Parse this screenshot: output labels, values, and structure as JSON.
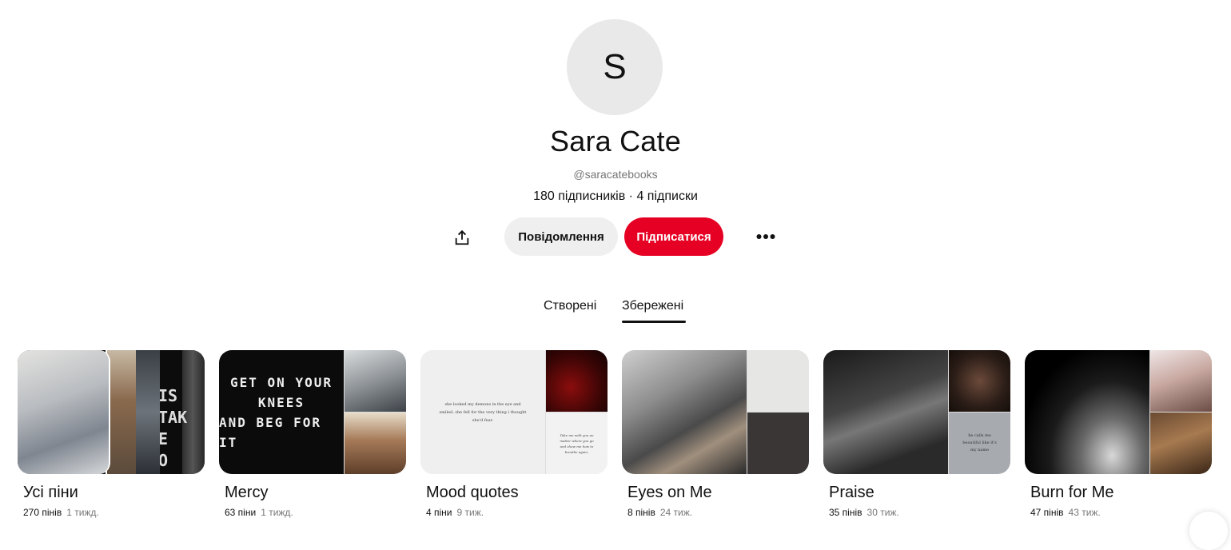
{
  "profile": {
    "initial": "S",
    "name": "Sara Cate",
    "handle": "@saracatebooks",
    "stats": "180 підписників · 4 підписки"
  },
  "actions": {
    "message_label": "Повідомлення",
    "follow_label": "Підписатися",
    "share_icon": "share-icon",
    "more_icon": "more-dots-icon"
  },
  "tabs": [
    {
      "label": "Створені",
      "active": false
    },
    {
      "label": "Збережені",
      "active": true
    }
  ],
  "boards": [
    {
      "title": "Усі піни",
      "pins": "270 пінів",
      "updated": "1 тижд."
    },
    {
      "title": "Mercy",
      "pins": "63 піни",
      "updated": "1 тижд.",
      "cover_text": [
        "GET ON YOUR",
        "KNEES",
        "AND BEG FOR IT"
      ]
    },
    {
      "title": "Mood quotes",
      "pins": "4 піни",
      "updated": "9 тиж.",
      "cover_text": "she looked my demons in the eye and smiled. she fell for the very thing i thought she'd fear.",
      "side_text": "Take me with you no matter where you go and show me how to breathe again."
    },
    {
      "title": "Eyes on Me",
      "pins": "8 пінів",
      "updated": "24 тиж."
    },
    {
      "title": "Praise",
      "pins": "35 пінів",
      "updated": "30 тиж.",
      "side_text": "he calls me beautiful like it's my name"
    },
    {
      "title": "Burn for Me",
      "pins": "47 пінів",
      "updated": "43 тиж."
    }
  ],
  "colors": {
    "accent": "#e60023",
    "secondary_button": "#efefef",
    "avatar_bg": "#e9e9e9"
  }
}
